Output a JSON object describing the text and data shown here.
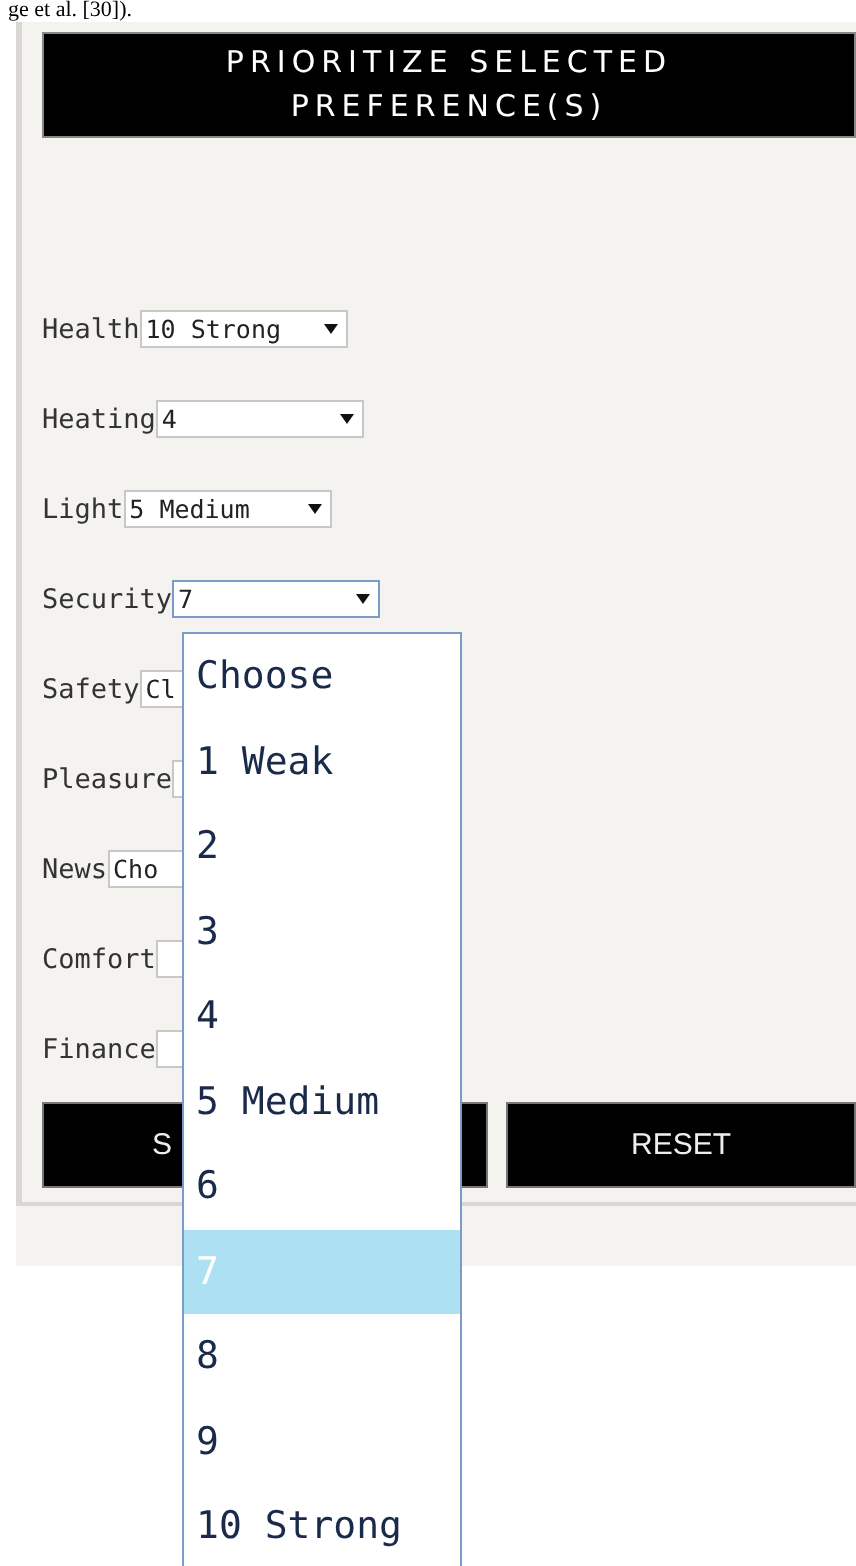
{
  "caption": "ge et al. [30]).",
  "header": "PRIORITIZE SELECTED PREFERENCE(S)",
  "preferences": [
    {
      "label": "Health",
      "value": "10 Strong",
      "focused": false
    },
    {
      "label": "Heating",
      "value": "4",
      "focused": false
    },
    {
      "label": "Light",
      "value": "5 Medium",
      "focused": false
    },
    {
      "label": "Security",
      "value": "7",
      "focused": true
    },
    {
      "label": "Safety",
      "value": "Cl",
      "focused": false
    },
    {
      "label": "Pleasure",
      "focused": false
    },
    {
      "label": "News",
      "value": "Cho",
      "focused": false
    },
    {
      "label": "Comfort",
      "focused": false
    },
    {
      "label": "Finance",
      "focused": false
    }
  ],
  "buttons": [
    {
      "label": "S"
    },
    {
      "label": "RESET"
    }
  ],
  "dropdown": {
    "options": [
      {
        "label": "Choose",
        "selected": false
      },
      {
        "label": "1 Weak",
        "selected": false
      },
      {
        "label": "2",
        "selected": false
      },
      {
        "label": "3",
        "selected": false
      },
      {
        "label": "4",
        "selected": false
      },
      {
        "label": "5 Medium",
        "selected": false
      },
      {
        "label": "6",
        "selected": false
      },
      {
        "label": "7",
        "selected": true
      },
      {
        "label": "8",
        "selected": false
      },
      {
        "label": "9",
        "selected": false
      },
      {
        "label": "10 Strong",
        "selected": false
      }
    ]
  }
}
